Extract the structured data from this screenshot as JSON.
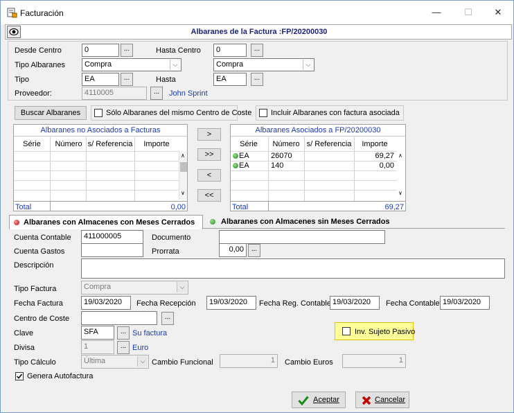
{
  "window": {
    "title": "Facturación",
    "minimize": "—",
    "maximize": "☐",
    "close": "✕"
  },
  "header": {
    "title": "Albaranes de la Factura :FP/20200030"
  },
  "filters": {
    "desde_centro_label": "Desde Centro",
    "desde_centro_value": "0",
    "hasta_centro_label": "Hasta Centro",
    "hasta_centro_value": "0",
    "tipo_albaranes_label": "Tipo Albaranes",
    "tipo_albaranes_value": "Compra",
    "tipo_albaranes_value2": "Compra",
    "tipo_label": "Tipo",
    "tipo_value": "EA",
    "hasta_label": "Hasta",
    "hasta_value": "EA",
    "proveedor_label": "Proveedor:",
    "proveedor_value": "4110005",
    "proveedor_name": "John Sprint"
  },
  "search": {
    "buscar_label": "Buscar Albaranes",
    "solo_label": "Sólo Albaranes del mismo Centro de Coste",
    "incluir_label": "Incluir Albaranes con factura asociada"
  },
  "left_grid": {
    "title": "Albaranes no Asociados a Facturas",
    "columns": [
      "Série",
      "Número",
      "s/ Referencia",
      "Importe"
    ],
    "total_label": "Total",
    "total_value": "0,00"
  },
  "transfer": {
    "right": ">",
    "all_right": ">>",
    "left": "<",
    "all_left": "<<"
  },
  "right_grid": {
    "title": "Albaranes Asociados a FP/20200030",
    "columns": [
      "Série",
      "Número",
      "s/ Referencia",
      "Importe"
    ],
    "rows": [
      {
        "serie": "EA",
        "numero": "26070",
        "referencia": "",
        "importe": "69,27"
      },
      {
        "serie": "EA",
        "numero": "140",
        "referencia": "",
        "importe": "0,00"
      }
    ],
    "total_label": "Total",
    "total_value": "69,27"
  },
  "tabs": {
    "con_meses": "Albaranes con Almacenes con Meses Cerrados",
    "sin_meses": "Albaranes con Almacenes sin Meses Cerrados"
  },
  "form": {
    "cuenta_contable_label": "Cuenta Contable",
    "cuenta_contable_value": "411000005",
    "documento_label": "Documento",
    "documento_value": "",
    "cuenta_gastos_label": "Cuenta Gastos",
    "cuenta_gastos_value": "",
    "prorrata_label": "Prorrata",
    "prorrata_value": "0,00",
    "descripcion_label": "Descripción",
    "descripcion_value": "",
    "tipo_factura_label": "Tipo Factura",
    "tipo_factura_value": "Compra",
    "fecha_factura_label": "Fecha Factura",
    "fecha_factura_value": "19/03/2020",
    "fecha_recepcion_label": "Fecha Recepción",
    "fecha_recepcion_value": "19/03/2020",
    "fecha_reg_label": "Fecha Reg. Contable",
    "fecha_reg_value": "19/03/2020",
    "fecha_contable_label": "Fecha Contable",
    "fecha_contable_value": "19/03/2020",
    "centro_coste_label": "Centro de Coste",
    "centro_coste_value": "",
    "clave_label": "Clave",
    "clave_value": "SFA",
    "clave_desc": "Su factura",
    "inv_label": "Inv. Sujeto Pasivo",
    "divisa_label": "Divisa",
    "divisa_value": "1",
    "divisa_desc": "Euro",
    "tipo_calculo_label": "Tipo Cálculo",
    "tipo_calculo_value": "Última",
    "cambio_funcional_label": "Cambio Funcional",
    "cambio_funcional_value": "1",
    "cambio_euros_label": "Cambio Euros",
    "cambio_euros_value": "1",
    "genera_label": "Genera Autofactura"
  },
  "footer": {
    "aceptar_label": "Aceptar",
    "cancelar_label": "Cancelar"
  },
  "icons": {
    "aceptar": "check-icon",
    "cancelar": "x-icon"
  }
}
